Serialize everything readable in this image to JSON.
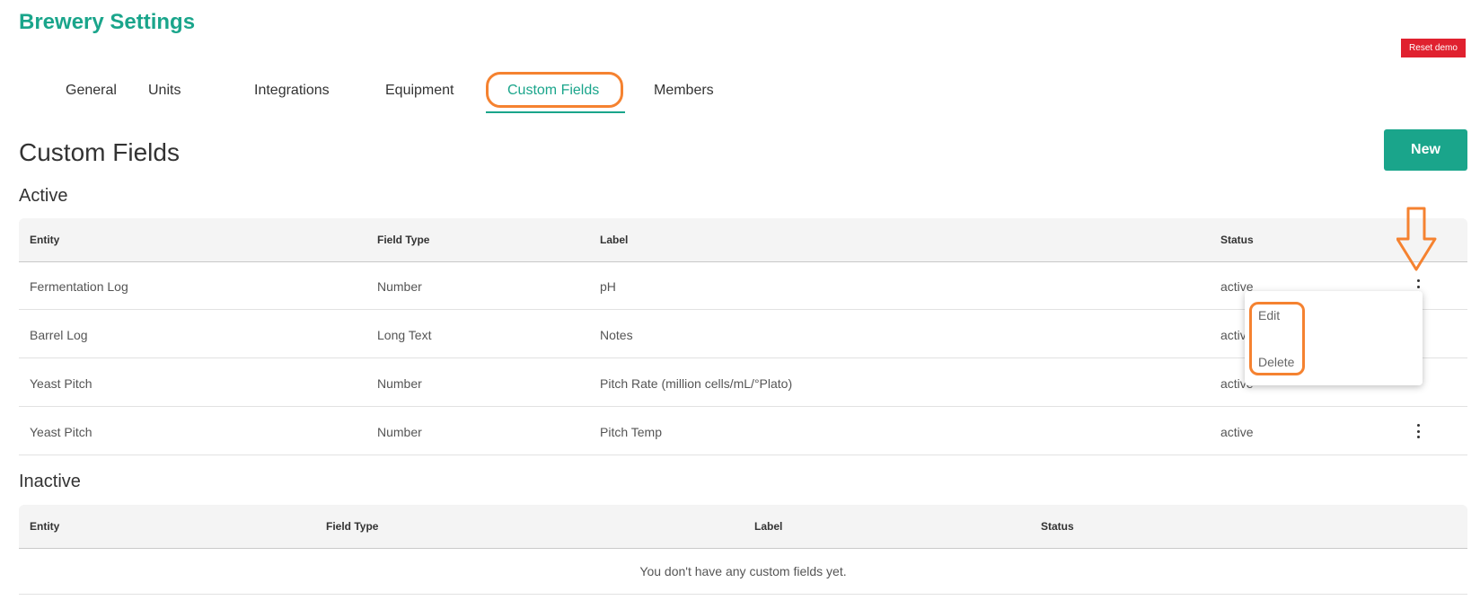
{
  "header": {
    "title": "Brewery Settings",
    "reset_label": "Reset demo"
  },
  "tabs": [
    {
      "label": "General"
    },
    {
      "label": "Units"
    },
    {
      "label": "Integrations"
    },
    {
      "label": "Equipment"
    },
    {
      "label": "Custom Fields",
      "active": true
    },
    {
      "label": "Members"
    }
  ],
  "page": {
    "title": "Custom Fields",
    "new_label": "New"
  },
  "active_section": {
    "title": "Active",
    "columns": [
      "Entity",
      "Field Type",
      "Label",
      "Status"
    ],
    "rows": [
      {
        "entity": "Fermentation Log",
        "field_type": "Number",
        "label": "pH",
        "status": "active"
      },
      {
        "entity": "Barrel Log",
        "field_type": "Long Text",
        "label": "Notes",
        "status": "activ"
      },
      {
        "entity": "Yeast Pitch",
        "field_type": "Number",
        "label": "Pitch Rate (million cells/mL/°Plato)",
        "status": "active"
      },
      {
        "entity": "Yeast Pitch",
        "field_type": "Number",
        "label": "Pitch Temp",
        "status": "active"
      }
    ]
  },
  "context_menu": {
    "items": [
      {
        "label": "Edit"
      },
      {
        "label": "Delete"
      }
    ]
  },
  "inactive_section": {
    "title": "Inactive",
    "columns": [
      "Entity",
      "Field Type",
      "Label",
      "Status"
    ],
    "empty_message": "You don't have any custom fields yet."
  },
  "colors": {
    "accent": "#1aa58b",
    "danger": "#e0212f",
    "highlight": "#f58230"
  }
}
